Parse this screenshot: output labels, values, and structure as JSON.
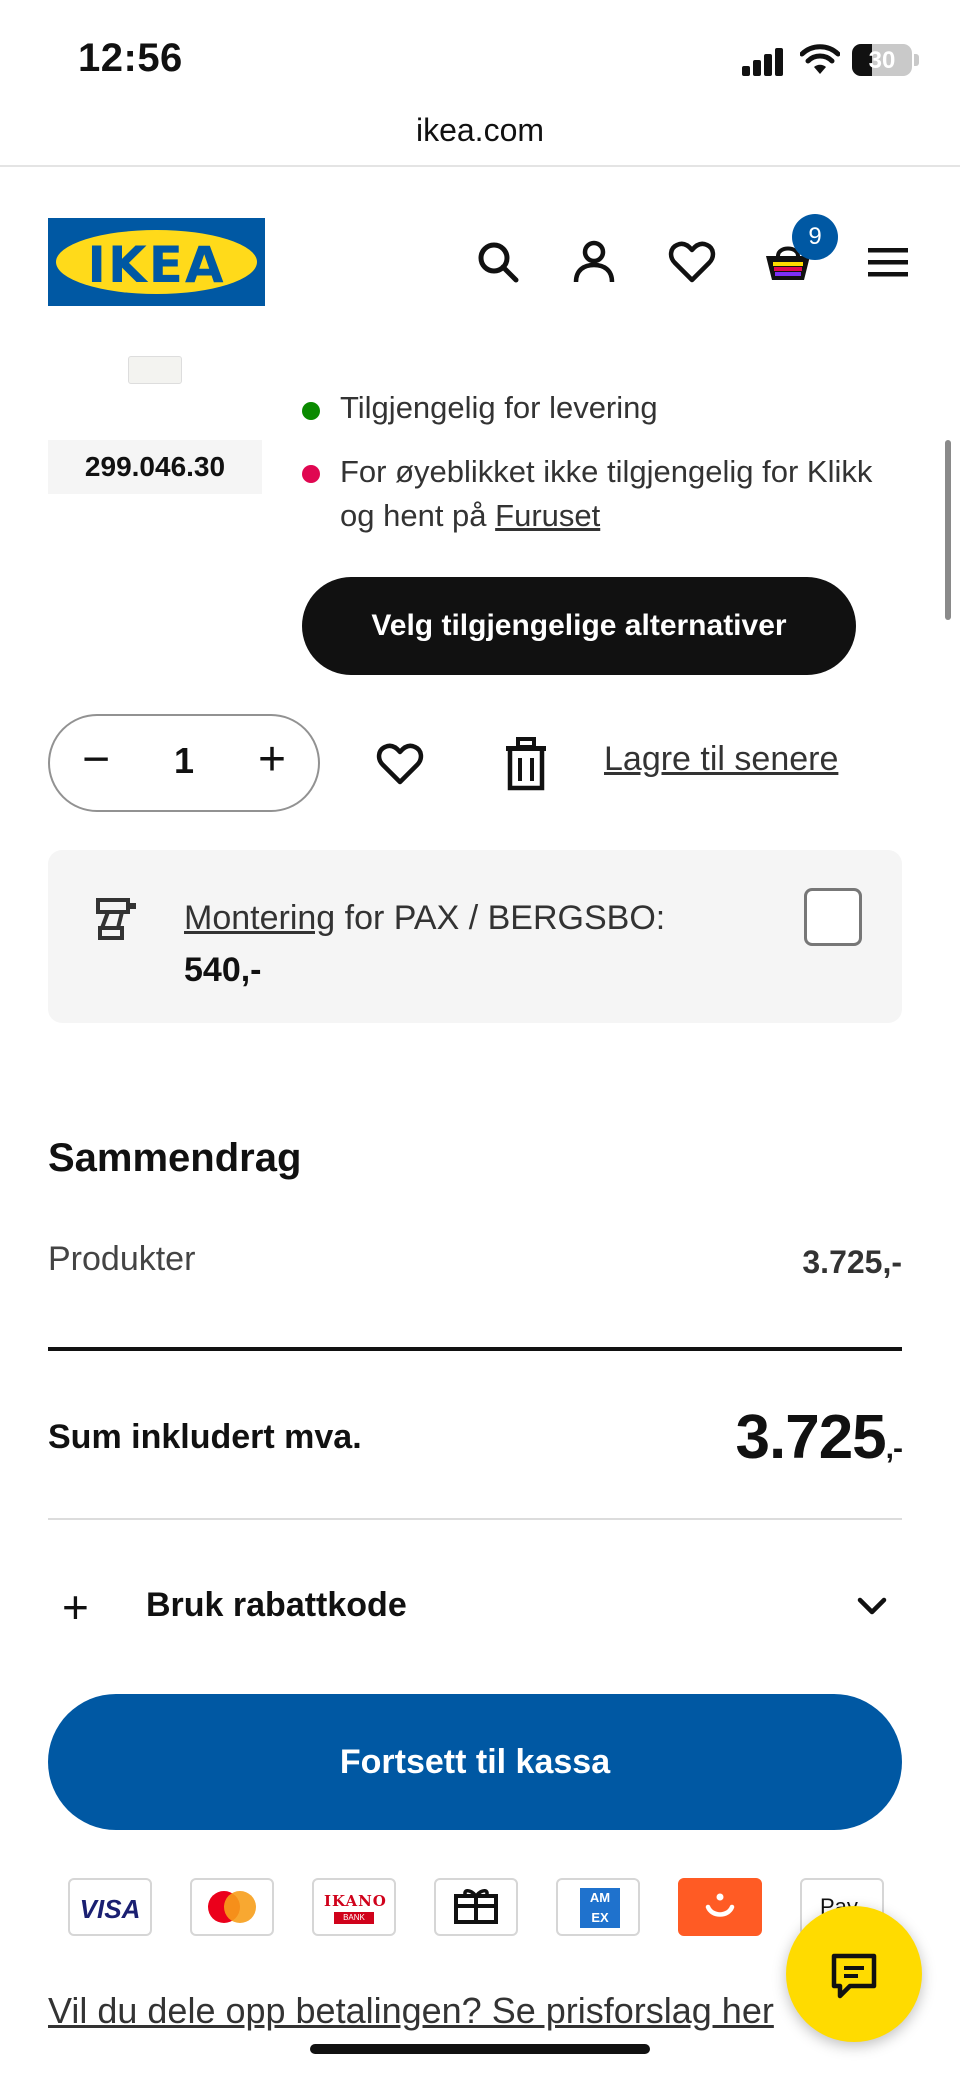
{
  "status_bar": {
    "time": "12:56",
    "battery": "30"
  },
  "browser": {
    "url": "ikea.com"
  },
  "header": {
    "logo_text": "IKEA",
    "cart_count": "9"
  },
  "product": {
    "article_number": "299.046.30",
    "availability": [
      {
        "text": "Tilgjengelig for levering",
        "status_color": "#0a8a00"
      },
      {
        "text_before": "For øyeblikket ikke tilgjengelig for Klikk",
        "text_line2": "og hent på ",
        "link": "Furuset",
        "status_color": "#e00751"
      }
    ],
    "alternatives_button": "Velg tilgjengelige alternativer",
    "quantity": "1",
    "save_later": "Lagre til senere",
    "assembly": {
      "link": "Montering",
      "text": " for PAX / BERGSBO:",
      "price": "540,-"
    }
  },
  "summary": {
    "title": "Sammendrag",
    "products_label": "Produkter",
    "products_value": "3.725,-",
    "total_label": "Sum inkludert mva.",
    "total_value": "3.725",
    "total_suffix": ",-",
    "discount_label": "Bruk rabattkode"
  },
  "checkout_button": "Fortsett til kassa",
  "payment_methods": [
    "visa-icon",
    "mastercard-icon",
    "ikano-bank-icon",
    "gift-card-icon",
    "amex-icon",
    "vipps-icon",
    "apple-pay-icon"
  ],
  "payment_labels": {
    "visa": "VISA",
    "ikano": "IKANO",
    "ikano_sub": "BANK",
    "amex": "AM EX",
    "apple": "Pay"
  },
  "split_payment_link": "Vil du dele opp betalingen? Se prisforslag her",
  "colors": {
    "ikea_blue": "#0058a3",
    "ikea_yellow": "#ffdb00"
  }
}
